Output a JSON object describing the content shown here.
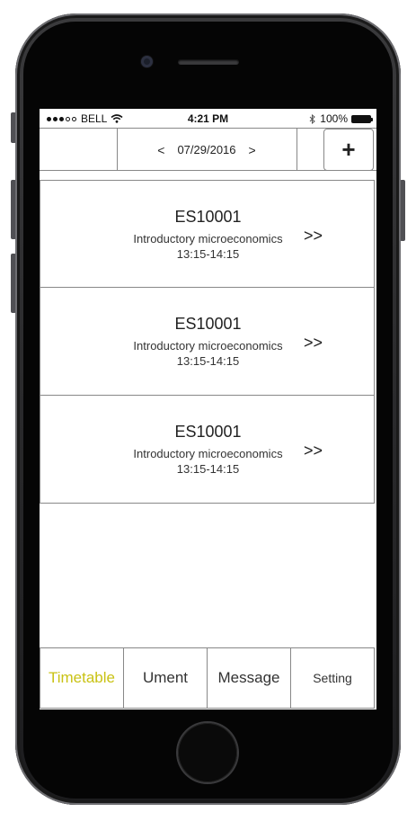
{
  "status_bar": {
    "carrier": "BELL",
    "time": "4:21 PM",
    "battery": "100%"
  },
  "header": {
    "prev_label": "<",
    "date": "07/29/2016",
    "next_label": ">",
    "add_label": "+"
  },
  "classes": [
    {
      "code": "ES10001",
      "name": "Introductory microeconomics",
      "time": "13:15-14:15",
      "open_label": ">>"
    },
    {
      "code": "ES10001",
      "name": "Introductory microeconomics",
      "time": "13:15-14:15",
      "open_label": ">>"
    },
    {
      "code": "ES10001",
      "name": "Introductory microeconomics",
      "time": "13:15-14:15",
      "open_label": ">>"
    }
  ],
  "tabs": [
    {
      "label": "Timetable",
      "active": true
    },
    {
      "label": "Ument",
      "active": false
    },
    {
      "label": "Message",
      "active": false
    },
    {
      "label": "Setting",
      "active": false
    }
  ],
  "colors": {
    "active_tab": "#c9c214",
    "border": "#888888"
  }
}
